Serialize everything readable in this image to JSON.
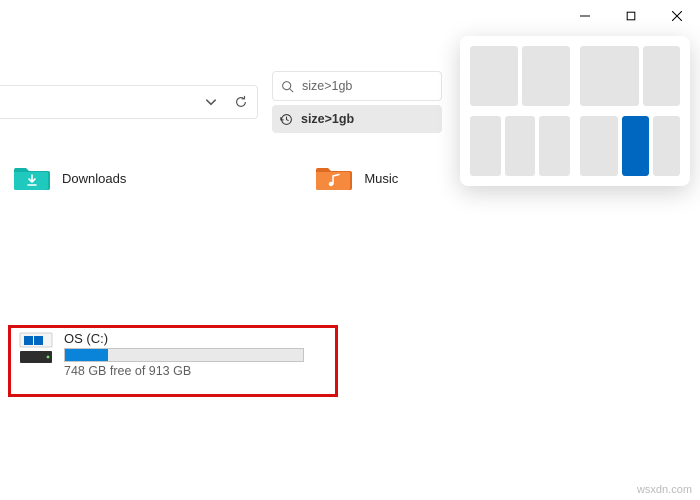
{
  "window": {
    "controls": {
      "minimize": "−",
      "maximize": "▢",
      "close": "✕"
    }
  },
  "toolbar": {
    "search": {
      "query": "size>1gb"
    },
    "suggestion": {
      "text": "size>1gb"
    }
  },
  "folders": [
    {
      "name": "Downloads",
      "icon": "downloads",
      "color": "#12b3a8"
    },
    {
      "name": "Music",
      "icon": "music",
      "color": "#f07d2f"
    }
  ],
  "drive": {
    "label": "OS (C:)",
    "free_text": "748 GB free of 913 GB",
    "fill_percent": 18
  },
  "snap_layouts": {
    "selected_group": 3,
    "selected_cell": 1
  },
  "watermark": "wsxdn.com"
}
